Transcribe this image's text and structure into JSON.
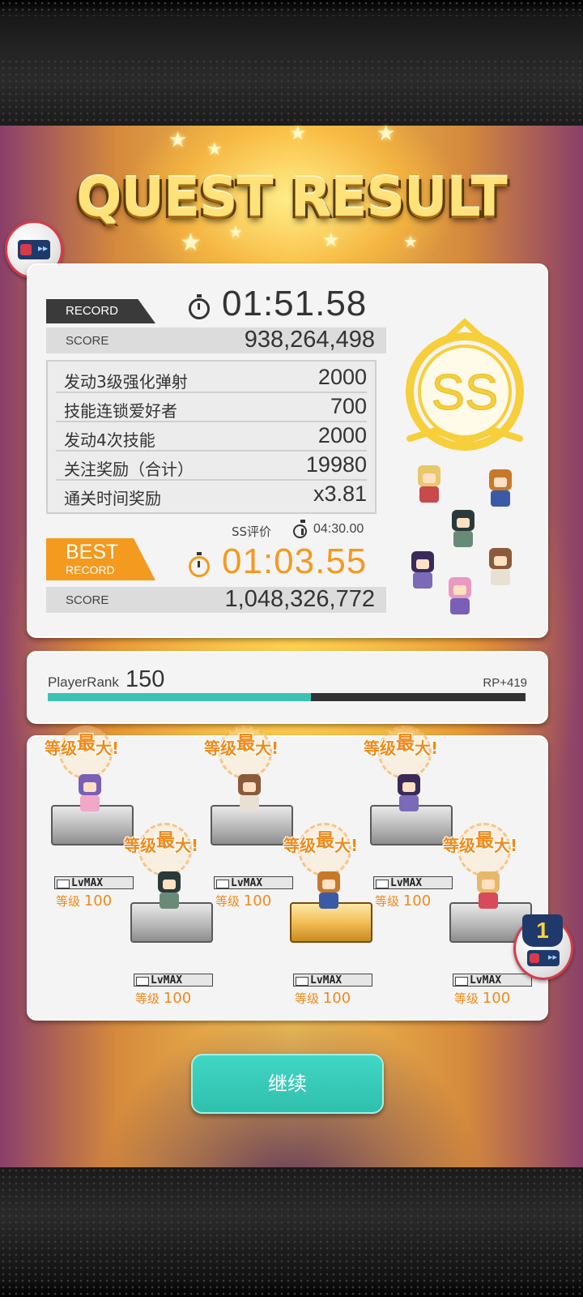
{
  "title": "QUEST RESULT",
  "record": {
    "tag": "RECORD",
    "time": "01:51.58",
    "score_label": "SCORE",
    "score": "938,264,498",
    "bonuses": [
      {
        "name": "发动3级强化弹射",
        "value": "2000"
      },
      {
        "name": "技能连锁爱好者",
        "value": "700"
      },
      {
        "name": "发动4次技能",
        "value": "2000"
      },
      {
        "name": "关注奖励（合计）",
        "value": "19980"
      },
      {
        "name": "通关时间奖励",
        "value": "x3.81"
      }
    ],
    "ss_label": "SS评价",
    "ss_time": "04:30.00"
  },
  "best": {
    "tag_line1": "BEST",
    "tag_line2": "RECORD",
    "time": "01:03.55",
    "score_label": "SCORE",
    "score": "1,048,326,772"
  },
  "grade": "SS",
  "player_rank": {
    "label": "PlayerRank",
    "value": "150",
    "rp": "RP+419",
    "progress": 0.55
  },
  "level_max_text": {
    "a": "等级",
    "b": "最",
    "c": "大!"
  },
  "units": [
    {
      "lv_label": "LvMAX",
      "level_label": "等级",
      "level": "100",
      "pedestal": "stone",
      "palette": [
        "#7a5fb8",
        "#f2a6c8"
      ]
    },
    {
      "lv_label": "LvMAX",
      "level_label": "等级",
      "level": "100",
      "pedestal": "stone",
      "palette": [
        "#2a3a3a",
        "#6a8a78"
      ]
    },
    {
      "lv_label": "LvMAX",
      "level_label": "等级",
      "level": "100",
      "pedestal": "stone",
      "palette": [
        "#8a5a3a",
        "#e8e0d2"
      ]
    },
    {
      "lv_label": "LvMAX",
      "level_label": "等级",
      "level": "100",
      "pedestal": "gold",
      "palette": [
        "#c8782a",
        "#3a5aa8"
      ]
    },
    {
      "lv_label": "LvMAX",
      "level_label": "等级",
      "level": "100",
      "pedestal": "stone",
      "palette": [
        "#3a2a5a",
        "#7a6ab8"
      ]
    },
    {
      "lv_label": "LvMAX",
      "level_label": "等级",
      "level": "100",
      "pedestal": "stone",
      "palette": [
        "#e8b86a",
        "#d84a5a"
      ]
    }
  ],
  "party_icons": [
    {
      "palette": [
        "#e8c86a",
        "#c84a4a"
      ]
    },
    {
      "palette": [
        "#c8782a",
        "#3a5aa8"
      ]
    },
    {
      "palette": [
        "#2a3a3a",
        "#6a8a78"
      ]
    },
    {
      "palette": [
        "#3a2a5a",
        "#7a6ab8"
      ]
    },
    {
      "palette": [
        "#8a5a3a",
        "#e8e0d2"
      ]
    },
    {
      "palette": [
        "#e89ac0",
        "#7a5fb8"
      ]
    }
  ],
  "side_badge_number": "1",
  "continue_label": "继续",
  "colors": {
    "accent": "#f39a1f",
    "teal": "#3cc2b3",
    "gold": "#ffd23a"
  }
}
